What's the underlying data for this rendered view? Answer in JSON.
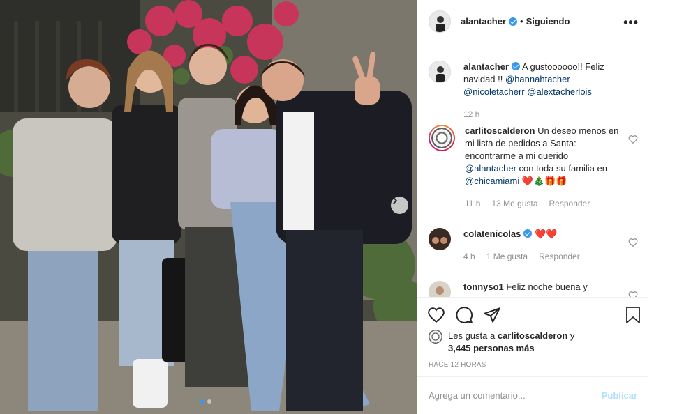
{
  "post": {
    "photo_alt": "",
    "carousel": {
      "total_slides": 2,
      "active_index": 0
    }
  },
  "header": {
    "username": "alantacher",
    "separator": "•",
    "follow_status": "Siguiendo",
    "more_label": "•••"
  },
  "caption": {
    "username": "alantacher",
    "text": "A gustoooooo!! Feliz navidad !!",
    "mentions": [
      "@hannahtacher",
      "@nicoletacherr",
      "@alextacherlois"
    ],
    "time": "12 h"
  },
  "comments": [
    {
      "username": "carlitoscalderon",
      "text_before": "Un deseo menos en mi lista de pedidos a Santa: encontrarme a mi querido",
      "mention1": "@alantacher",
      "text_middle": "con toda su familia en",
      "mention2": "@chicamiami",
      "emoji": "❤️🎄🎁🎁",
      "time": "11 h",
      "likes": "13 Me gusta",
      "reply": "Responder"
    },
    {
      "username": "colatenicolas",
      "emoji": "❤️❤️",
      "time": "4 h",
      "likes": "1 Me gusta",
      "reply": "Responder"
    },
    {
      "username": "tonnyso1",
      "text": "Feliz noche buena y"
    }
  ],
  "likes_summary": {
    "prefix": "Les gusta a",
    "username": "carlitoscalderon",
    "conj": "y",
    "count_text": "3,445 personas más"
  },
  "posted_ago": "HACE 12 HORAS",
  "add_comment": {
    "placeholder": "Agrega un comentario...",
    "publish_label": "Publicar"
  },
  "colors": {
    "accent": "#3897f0",
    "mention": "#003569",
    "muted": "#8e8e8e",
    "publish_disabled": "#b2dffc"
  }
}
